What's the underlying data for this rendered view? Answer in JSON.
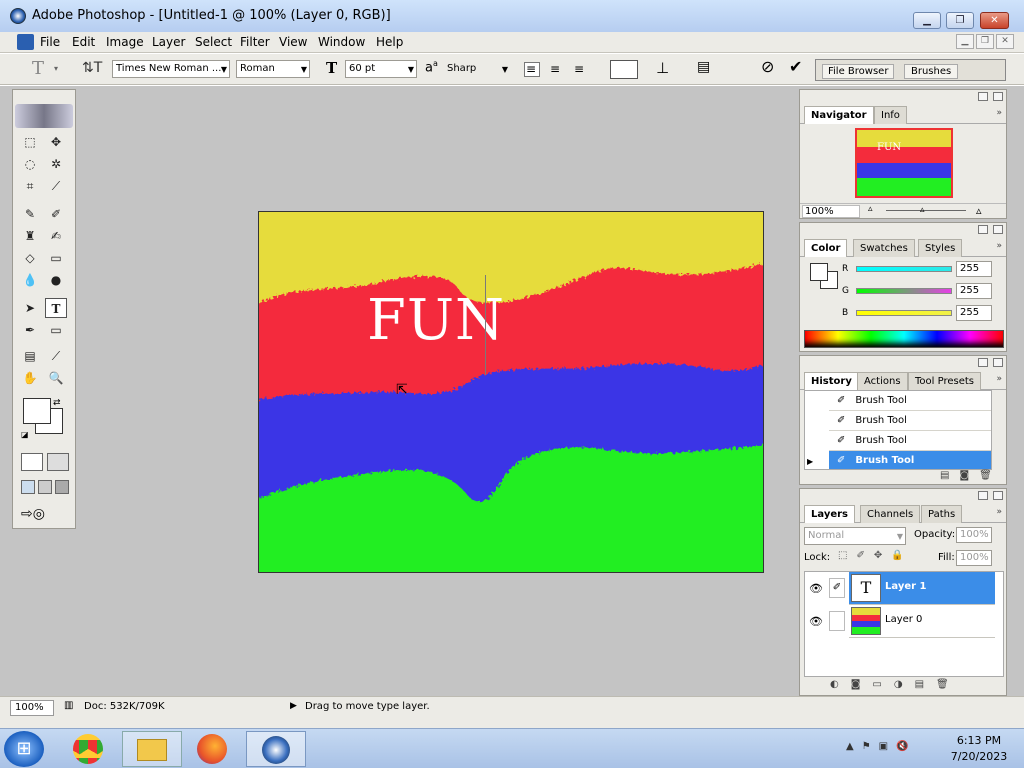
{
  "window": {
    "title": "Adobe Photoshop - [Untitled-1 @ 100% (Layer 0, RGB)]"
  },
  "menu": [
    "File",
    "Edit",
    "Image",
    "Layer",
    "Select",
    "Filter",
    "View",
    "Window",
    "Help"
  ],
  "options": {
    "font_family": "Times New Roman ...",
    "font_style": "Roman",
    "font_size": "60 pt",
    "aa_label": "a",
    "aa_mode": "Sharp",
    "file_browser": "File Browser",
    "brushes": "Brushes"
  },
  "canvas": {
    "text": "FUN"
  },
  "navigator": {
    "tabs": [
      "Navigator",
      "Info"
    ],
    "zoom": "100%",
    "thumb_text": "FUN"
  },
  "color": {
    "tabs": [
      "Color",
      "Swatches",
      "Styles"
    ],
    "channels": [
      {
        "label": "R",
        "value": "255",
        "color": "#2ee8e8"
      },
      {
        "label": "G",
        "value": "255",
        "color": "#e83ee8"
      },
      {
        "label": "B",
        "value": "255",
        "color": "#f0f04a"
      }
    ]
  },
  "history": {
    "tabs": [
      "History",
      "Actions",
      "Tool Presets"
    ],
    "items": [
      "Brush Tool",
      "Brush Tool",
      "Brush Tool",
      "Brush Tool"
    ]
  },
  "layers": {
    "tabs": [
      "Layers",
      "Channels",
      "Paths"
    ],
    "blend_mode": "Normal",
    "opacity_label": "Opacity:",
    "opacity": "100%",
    "lock_label": "Lock:",
    "fill_label": "Fill:",
    "fill": "100%",
    "items": [
      {
        "name": "Layer 1",
        "type": "text",
        "thumb": "T"
      },
      {
        "name": "Layer 0",
        "type": "image",
        "thumb": ""
      }
    ]
  },
  "status": {
    "zoom": "100%",
    "doc": "Doc: 532K/709K",
    "hint": "Drag to move type layer."
  },
  "taskbar": {
    "time": "6:13 PM",
    "date": "7/20/2023"
  },
  "colors": {
    "accent": "#3b8de8",
    "yellow": "#e6dc3c",
    "red": "#f42c3c",
    "blue": "#3a36e6",
    "green": "#22ee22"
  }
}
